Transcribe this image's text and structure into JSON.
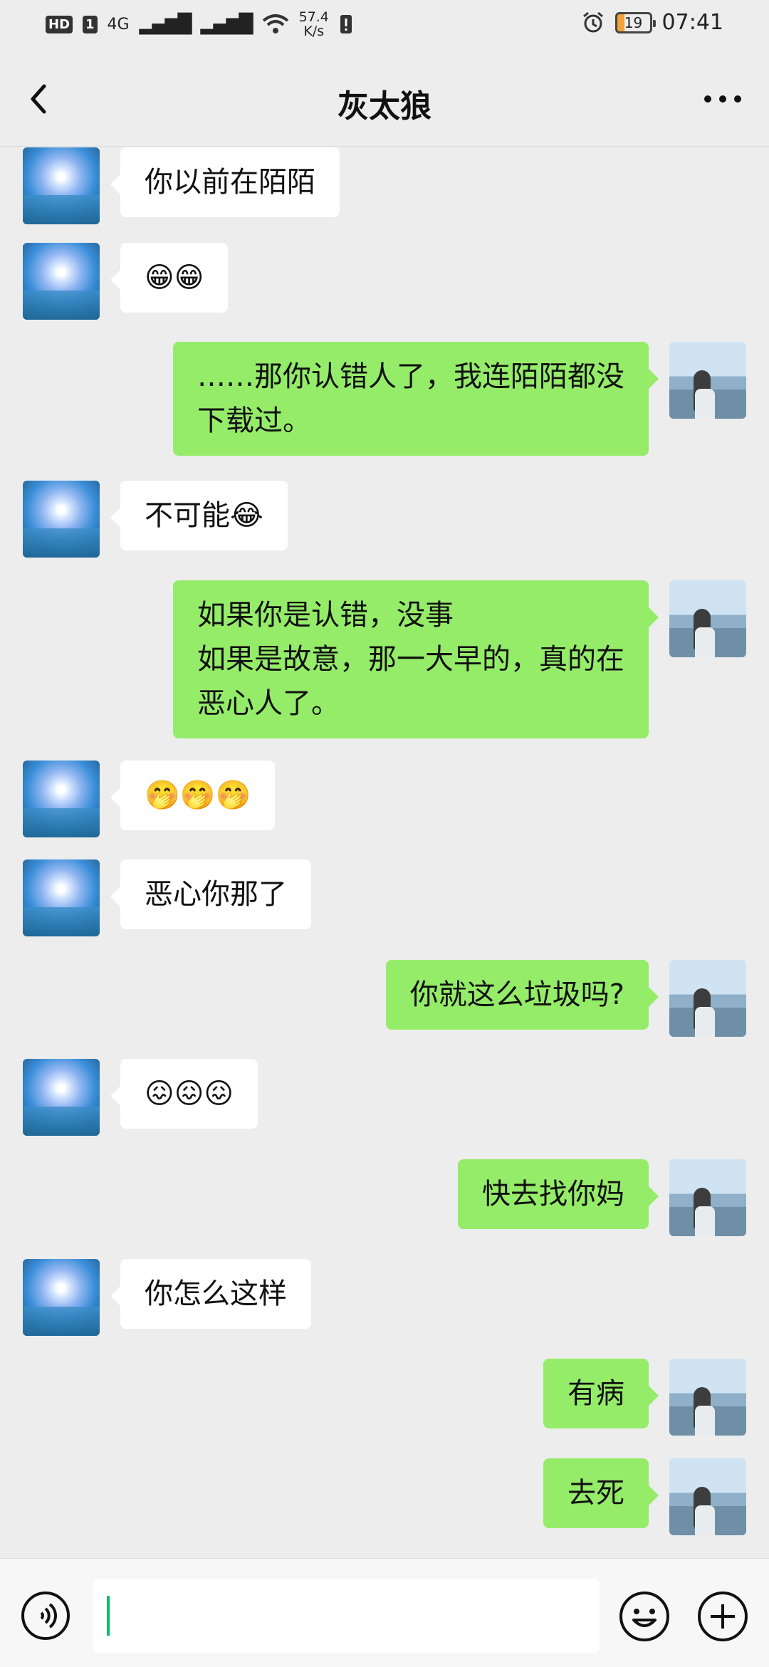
{
  "status_bar": {
    "hd_badge": "HD",
    "sim_badge": "1",
    "network": "4G",
    "signal": "▂▄▆█",
    "signal2": "▂▄▆█",
    "net_speed_value": "57.4",
    "net_speed_unit": "K/s",
    "battery": "19",
    "time": "07:41"
  },
  "header": {
    "title": "灰太狼"
  },
  "messages": [
    {
      "side": "left",
      "text": "你以前在陌陌"
    },
    {
      "side": "left",
      "text": "😁😁"
    },
    {
      "side": "right",
      "text": "……那你认错人了，我连陌陌都没\n下载过。"
    },
    {
      "side": "left",
      "text": "不可能😂"
    },
    {
      "side": "right",
      "text": "如果你是认错，没事\n如果是故意，那一大早的，真的在\n恶心人了。"
    },
    {
      "side": "left",
      "text": "🤭🤭🤭"
    },
    {
      "side": "left",
      "text": "恶心你那了"
    },
    {
      "side": "right",
      "text": "你就这么垃圾吗?"
    },
    {
      "side": "left",
      "text": "😖😖😖"
    },
    {
      "side": "right",
      "text": "快去找你妈"
    },
    {
      "side": "left",
      "text": "你怎么这样"
    },
    {
      "side": "right",
      "text": "有病"
    },
    {
      "side": "right",
      "text": "去死"
    }
  ],
  "input": {
    "placeholder": ""
  },
  "colors": {
    "background": "#ededed",
    "sent_bubble": "#95ec69",
    "received_bubble": "#ffffff",
    "accent": "#07c160"
  }
}
